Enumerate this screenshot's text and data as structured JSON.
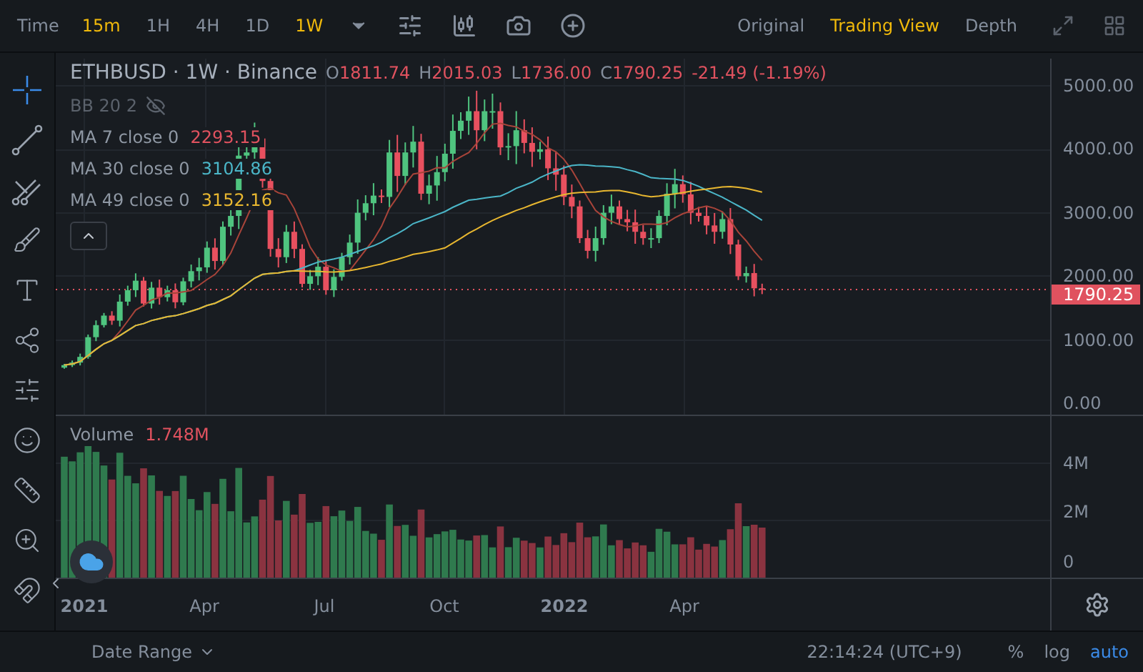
{
  "toolbar": {
    "time_label": "Time",
    "intervals": [
      {
        "label": "15m",
        "selected": true
      },
      {
        "label": "1H",
        "selected": false
      },
      {
        "label": "4H",
        "selected": false
      },
      {
        "label": "1D",
        "selected": false
      },
      {
        "label": "1W",
        "selected": true
      }
    ],
    "views": [
      {
        "label": "Original",
        "selected": false
      },
      {
        "label": "Trading View",
        "selected": true
      },
      {
        "label": "Depth",
        "selected": false
      }
    ]
  },
  "tools": [
    {
      "kind": "crosshair",
      "selected": true
    },
    {
      "kind": "line",
      "selected": false
    },
    {
      "kind": "pitchfork",
      "selected": false
    },
    {
      "kind": "brush",
      "selected": false
    },
    {
      "kind": "text",
      "selected": false
    },
    {
      "kind": "pattern",
      "selected": false
    },
    {
      "kind": "sliders",
      "selected": false
    },
    {
      "kind": "smile",
      "selected": false
    },
    {
      "kind": "ruler",
      "selected": false
    },
    {
      "kind": "zoom",
      "selected": false
    },
    {
      "kind": "magnet",
      "selected": false
    }
  ],
  "legend": {
    "title": "ETHBUSD · 1W · Binance",
    "ohlc": [
      {
        "label": "O",
        "value": "1811.74"
      },
      {
        "label": "H",
        "value": "2015.03"
      },
      {
        "label": "L",
        "value": "1736.00"
      },
      {
        "label": "C",
        "value": "1790.25"
      }
    ],
    "change": "-21.49 (-1.19%)",
    "indicators": [
      {
        "kind": "bb",
        "label": "BB 20 2",
        "hidden": true
      },
      {
        "kind": "ma",
        "label": "MA 7 close 0",
        "value": "2293.15",
        "color": "#e0525f"
      },
      {
        "kind": "ma",
        "label": "MA 30 close 0",
        "value": "3104.86",
        "color": "#4bb6c8"
      },
      {
        "kind": "ma",
        "label": "MA 49 close 0",
        "value": "3152.16",
        "color": "#e8b730"
      }
    ]
  },
  "price_axis": [
    "5000.00",
    "4000.00",
    "3000.00",
    "2000.00",
    "1000.00",
    "0.00"
  ],
  "last_price": "1790.25",
  "volume": {
    "label": "Volume",
    "value": "1.748M"
  },
  "volume_axis": [
    "4M",
    "2M",
    "0"
  ],
  "time_axis": [
    {
      "label": "2021",
      "kind": "year"
    },
    {
      "label": "Apr",
      "kind": "month"
    },
    {
      "label": "Jul",
      "kind": "month"
    },
    {
      "label": "Oct",
      "kind": "month"
    },
    {
      "label": "2022",
      "kind": "year"
    },
    {
      "label": "Apr",
      "kind": "month"
    }
  ],
  "bottom": {
    "date_range": "Date Range",
    "time": "22:14:24 (UTC+9)",
    "scale_modes": [
      {
        "label": "%",
        "selected": false
      },
      {
        "label": "log",
        "selected": false
      },
      {
        "label": "auto",
        "selected": true
      }
    ]
  }
}
